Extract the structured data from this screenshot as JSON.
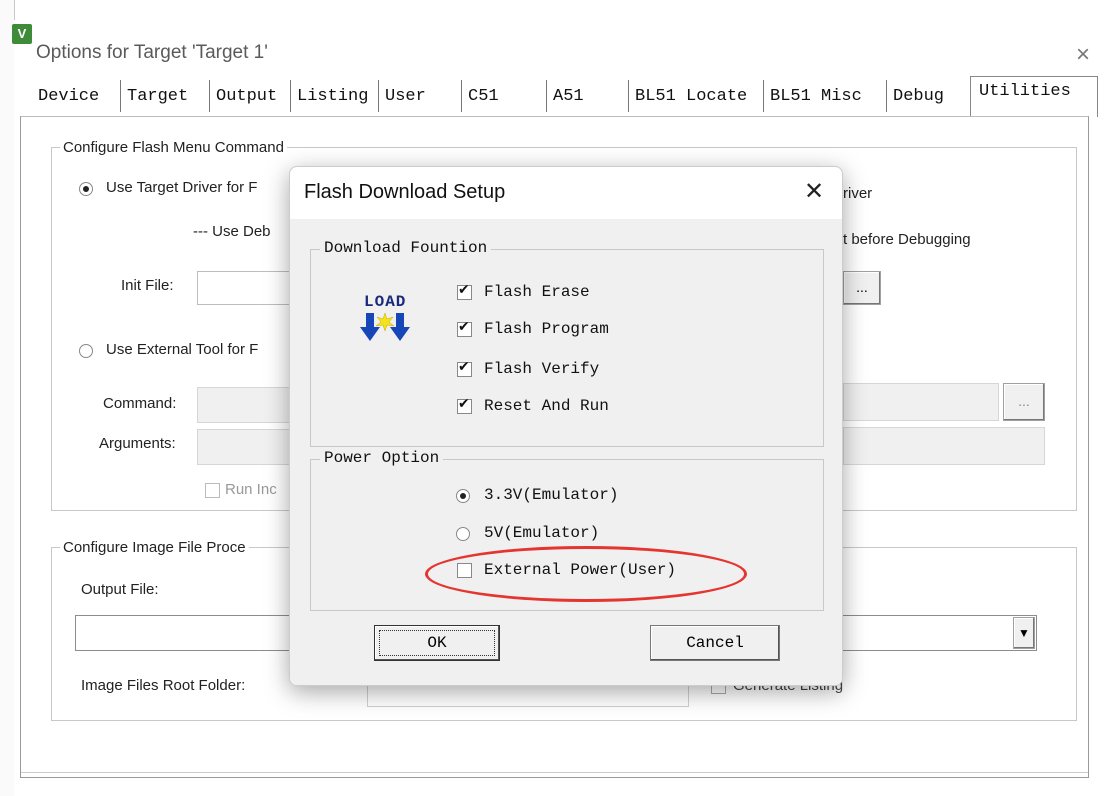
{
  "outer_window": {
    "title": "Options for Target 'Target 1'",
    "app_icon_glyph": "V",
    "close_glyph": "×"
  },
  "tabs": [
    {
      "label": "Device"
    },
    {
      "label": "Target"
    },
    {
      "label": "Output"
    },
    {
      "label": "Listing"
    },
    {
      "label": "User"
    },
    {
      "label": "C51"
    },
    {
      "label": "A51"
    },
    {
      "label": "BL51 Locate"
    },
    {
      "label": "BL51 Misc"
    },
    {
      "label": "Debug"
    },
    {
      "label": "Utilities"
    }
  ],
  "flash_menu": {
    "legend": "Configure Flash Menu Command",
    "use_target_driver": "Use Target Driver for F",
    "use_debug": "--- Use Deb",
    "right_driver": "river",
    "right_debugging": "t before Debugging",
    "init_file_label": "Init File:",
    "browse_label": "...",
    "use_external_tool": "Use External Tool for F",
    "command_label": "Command:",
    "arguments_label": "Arguments:",
    "run_independent": "Run Inc"
  },
  "image_file": {
    "legend": "Configure Image File Proce",
    "output_file_label": "Output File:",
    "root_folder_label": "Image Files Root Folder:",
    "generate_listing": "Generate Listing"
  },
  "dialog": {
    "title": "Flash Download Setup",
    "close_glyph": "✕",
    "download_group": "Download Fountion",
    "load_icon_text": "LOAD",
    "options": [
      {
        "label": "Flash Erase",
        "checked": true
      },
      {
        "label": "Flash Program",
        "checked": true
      },
      {
        "label": "Flash Verify",
        "checked": true
      },
      {
        "label": "Reset And Run",
        "checked": true
      }
    ],
    "power_group": "Power Option",
    "power_options": [
      {
        "label": "3.3V(Emulator)",
        "selected": true
      },
      {
        "label": "5V(Emulator)",
        "selected": false
      }
    ],
    "external_power": {
      "label": "External Power(User)",
      "checked": false
    },
    "ok_label": "OK",
    "cancel_label": "Cancel"
  },
  "colors": {
    "highlight_ring": "#e53530",
    "icon_green": "#3e8b3a",
    "dialog_bg": "#f0f0f0"
  }
}
